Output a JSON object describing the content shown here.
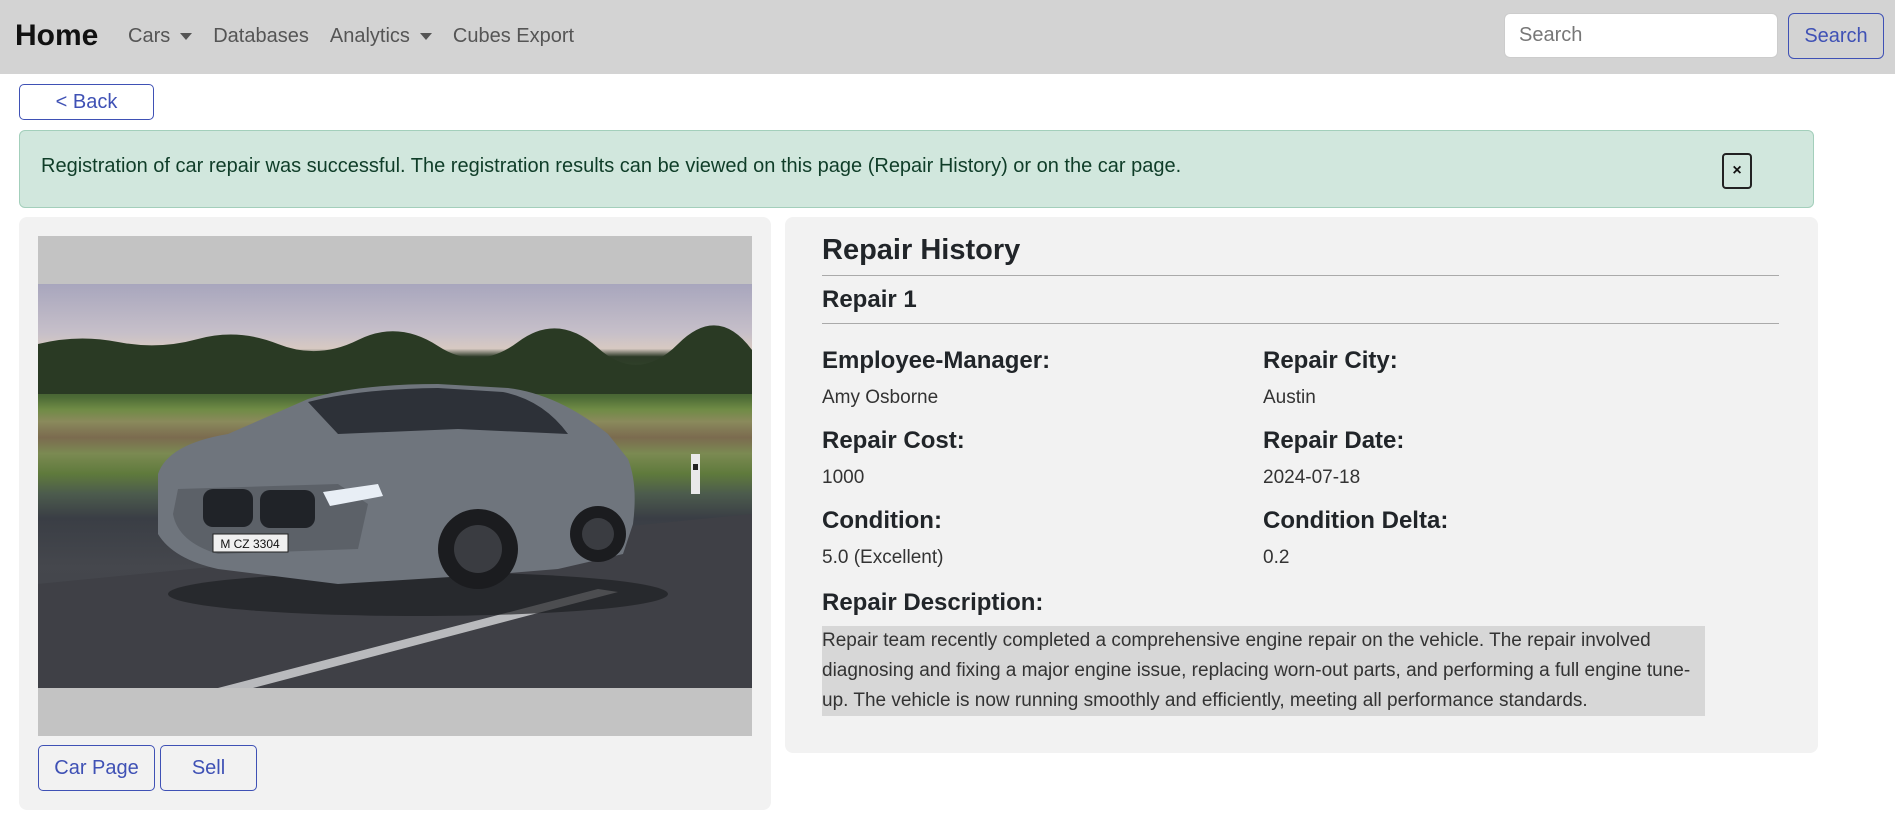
{
  "navbar": {
    "brand": "Home",
    "items": [
      {
        "label": "Cars",
        "dropdown": true
      },
      {
        "label": "Databases",
        "dropdown": false
      },
      {
        "label": "Analytics",
        "dropdown": true
      },
      {
        "label": "Cubes Export",
        "dropdown": false
      }
    ],
    "search_placeholder": "Search",
    "search_button": "Search"
  },
  "back_button": "< Back",
  "alert": {
    "message": "Registration of car repair was successful. The registration results can be viewed on this page (Repair History) or on the car page.",
    "close_label": "×"
  },
  "car_card": {
    "plate": "M CZ 3304",
    "buttons": [
      "Car Page",
      "Sell"
    ]
  },
  "repair_history": {
    "title": "Repair History",
    "repair_title": "Repair 1",
    "fields": {
      "employee_manager": {
        "label": "Employee-Manager:",
        "value": "Amy Osborne"
      },
      "repair_city": {
        "label": "Repair City:",
        "value": "Austin"
      },
      "repair_cost": {
        "label": "Repair Cost:",
        "value": "1000"
      },
      "repair_date": {
        "label": "Repair Date:",
        "value": "2024-07-18"
      },
      "condition": {
        "label": "Condition:",
        "value": "5.0 (Excellent)"
      },
      "condition_delta": {
        "label": "Condition Delta:",
        "value": "0.2"
      }
    },
    "description_label": "Repair Description:",
    "description": "Repair team recently completed a comprehensive engine repair on the vehicle. The repair involved diagnosing and fixing a major engine issue, replacing worn-out parts, and performing a full engine tune-up. The vehicle is now running smoothly and efficiently, meeting all performance standards."
  },
  "colors": {
    "navbar_bg": "#d3d3d3",
    "accent": "#3f51b5",
    "alert_bg": "#d1e7dd",
    "card_bg": "#f2f2f2"
  }
}
